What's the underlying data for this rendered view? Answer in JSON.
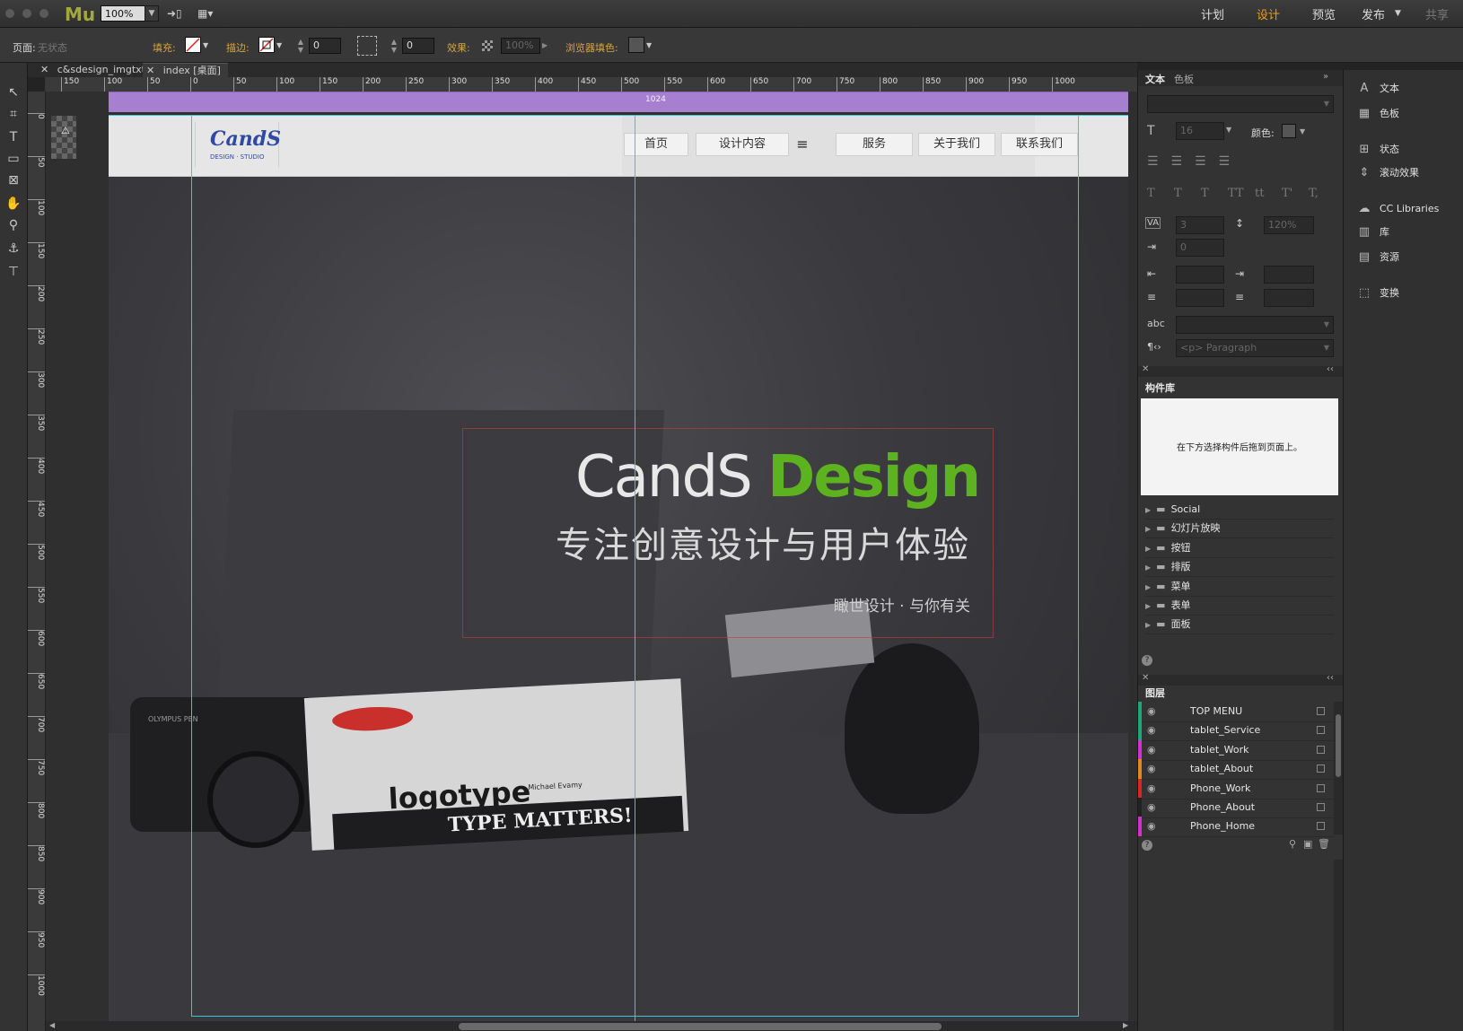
{
  "app": {
    "logo": "Mu",
    "zoom": "100%"
  },
  "modes": {
    "plan": "计划",
    "design": "设计",
    "preview": "预览",
    "publish": "发布",
    "share": "共享"
  },
  "toolbar": {
    "page_label": "页面:",
    "page_state": "无状态",
    "fill_label": "填充:",
    "stroke_label": "描边:",
    "stroke_value": "0",
    "corner_value": "0",
    "effect_label": "效果:",
    "effect_value": "100%",
    "browser_fill_label": "浏览器填色:"
  },
  "tabs": [
    {
      "label": "c&sdesign_imgtxt"
    },
    {
      "label": "index [桌面]"
    }
  ],
  "ruler": {
    "h": [
      "150",
      "100",
      "50",
      "0",
      "50",
      "100",
      "150",
      "200",
      "250",
      "300",
      "350",
      "400",
      "450",
      "500",
      "550",
      "600",
      "650",
      "700",
      "750",
      "800",
      "850",
      "900",
      "950",
      "1000"
    ],
    "v": [
      "0",
      "50",
      "100",
      "150",
      "200",
      "250",
      "300",
      "350",
      "400",
      "450",
      "500",
      "550",
      "600",
      "650",
      "700",
      "750",
      "800",
      "850",
      "900",
      "950",
      "1000"
    ]
  },
  "breakpoint": {
    "label": "1024"
  },
  "site": {
    "logo": "CandS",
    "logo_sub": "DESIGN · STUDIO",
    "nav": [
      "首页",
      "设计内容",
      "服务",
      "关于我们",
      "联系我们"
    ],
    "hero_title_a": "CandS ",
    "hero_title_b": "Design",
    "hero_sub": "专注创意设计与用户体验",
    "hero_tag": "瞰世设计 · 与你有关",
    "book1": "logotype",
    "book1_small": "Michael Evamy",
    "book2": "TYPE MATTERS!",
    "camera": "OLYMPUS PEN",
    "colors": {
      "accent": "#5db31f",
      "guide": "#3bc6d8",
      "breakpoint": "#a77fd1"
    }
  },
  "text_panel": {
    "tab_text": "文本",
    "tab_swatch": "色板",
    "font_size": "16",
    "color_label": "颜色:",
    "tracking": "3",
    "leading": "120%",
    "indent": "0",
    "paragraph": "<p> Paragraph",
    "type_styles": [
      "T",
      "T",
      "T",
      "TT",
      "tt",
      "T'",
      "T,"
    ]
  },
  "widgets": {
    "title": "构件库",
    "hint": "在下方选择构件后拖到页面上。",
    "items": [
      "Social",
      "幻灯片放映",
      "按钮",
      "排版",
      "菜单",
      "表单",
      "面板"
    ]
  },
  "layers": {
    "title": "图层",
    "items": [
      {
        "name": "TOP MENU",
        "color": "#1aa97a"
      },
      {
        "name": "tablet_Service",
        "color": "#1aa97a"
      },
      {
        "name": "tablet_Work",
        "color": "#d630d0"
      },
      {
        "name": "tablet_About",
        "color": "#e08a1a"
      },
      {
        "name": "Phone_Work",
        "color": "#d62a2a"
      },
      {
        "name": "Phone_About",
        "color": "#222222"
      },
      {
        "name": "Phone_Home",
        "color": "#d630d0"
      }
    ]
  },
  "strip": {
    "items": [
      "文本",
      "色板",
      "状态",
      "滚动效果",
      "CC Libraries",
      "库",
      "资源",
      "变换"
    ]
  }
}
